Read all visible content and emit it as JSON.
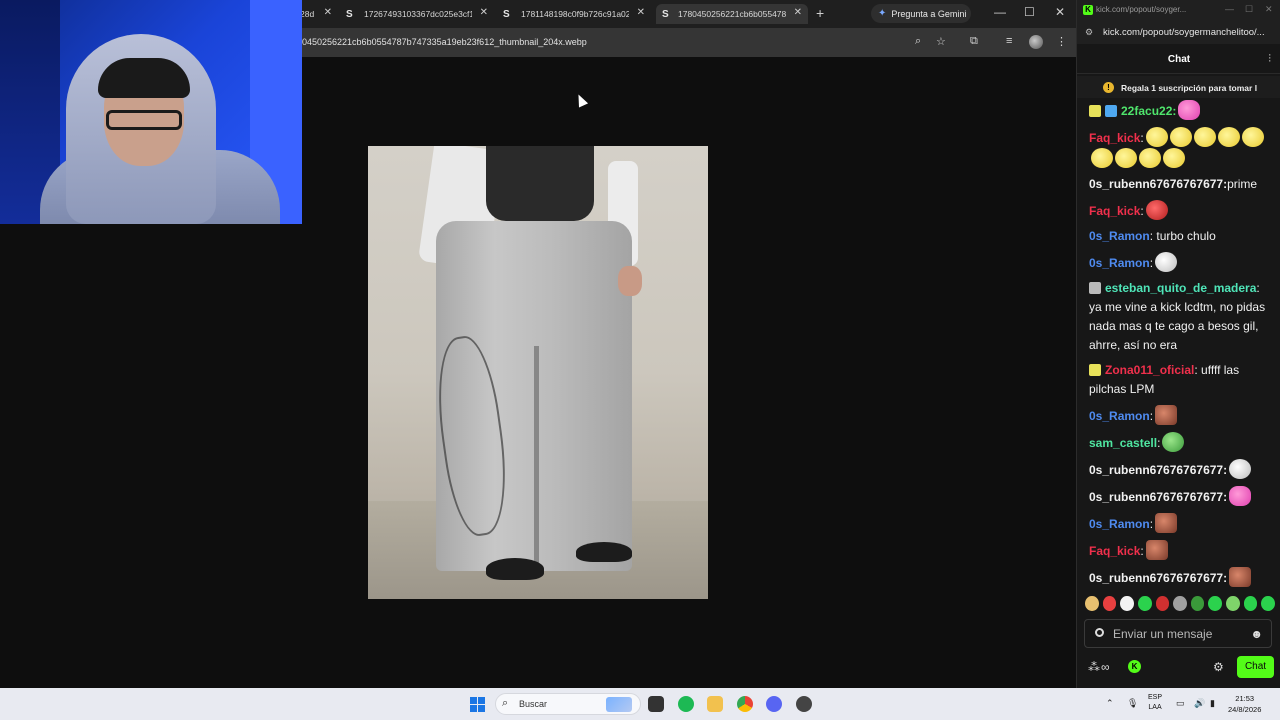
{
  "browser": {
    "tabs": [
      {
        "label": "28d",
        "active": false
      },
      {
        "label": "17267493103367dc025e3cf1f5",
        "active": false
      },
      {
        "label": "1781148198c0f9b726c91a02d",
        "active": false
      },
      {
        "label": "1780450256221cb6b0554787b",
        "active": true
      }
    ],
    "tab_favicon": "S",
    "new_tab": "+",
    "gemini_label": "Pregunta a Gemini",
    "url": "0450256221cb6b0554787b747335a19eb23f612_thumbnail_204x.webp"
  },
  "chat_window": {
    "title_url": "kick.com/popout/soyger...",
    "address": "kick.com/popout/soygermanchelitoo/...",
    "header": "Chat",
    "pinned": "Regala 1 suscripción para tomar l",
    "messages": [
      {
        "user": "22facu22:",
        "text": "",
        "color": "g",
        "badges": [
          "10",
          "sub"
        ],
        "emotes": [
          "em-p"
        ]
      },
      {
        "user": "Faq_kick",
        "text": ":",
        "color": "r",
        "badges": [],
        "emotes": [
          "em-y",
          "em-y",
          "em-y",
          "em-y",
          "em-y",
          "em-y",
          "em-y",
          "em-y",
          "em-y"
        ]
      },
      {
        "user": "0s_rubenn67676767677:",
        "text": "prime",
        "color": "w",
        "badges": [],
        "emotes": []
      },
      {
        "user": "Faq_kick",
        "text": ":",
        "color": "r",
        "badges": [],
        "emotes": [
          "em-r"
        ]
      },
      {
        "user": "0s_Ramon",
        "text": ": turbo chulo",
        "color": "b",
        "badges": [],
        "emotes": []
      },
      {
        "user": "0s_Ramon",
        "text": ":",
        "color": "b",
        "badges": [],
        "emotes": [
          "em-w"
        ]
      },
      {
        "user": "esteban_quito_de_madera",
        "text": ": ya me vine a kick lcdtm, no pidas nada mas q te cago a besos gil, ahrre, así no era",
        "color": "t",
        "badges": [
          "mod"
        ],
        "emotes": []
      },
      {
        "user": "Zona011_oficial",
        "text": ": uffff las pilchas LPM",
        "color": "z",
        "badges": [
          "12"
        ],
        "emotes": []
      },
      {
        "user": "0s_Ramon",
        "text": ":",
        "color": "b",
        "badges": [],
        "emotes": [
          "em-m"
        ]
      },
      {
        "user": "sam_castell",
        "text": ":",
        "color": "a",
        "badges": [],
        "emotes": [
          "em-f"
        ]
      },
      {
        "user": "0s_rubenn67676767677:",
        "text": "",
        "color": "w",
        "badges": [],
        "emotes": [
          "em-w"
        ]
      },
      {
        "user": "0s_rubenn67676767677:",
        "text": "",
        "color": "w",
        "badges": [],
        "emotes": [
          "em-p"
        ]
      },
      {
        "user": "0s_Ramon",
        "text": ":",
        "color": "b",
        "badges": [],
        "emotes": [
          "em-m"
        ]
      },
      {
        "user": "Faq_kick",
        "text": ":",
        "color": "r",
        "badges": [],
        "emotes": [
          "em-m"
        ]
      },
      {
        "user": "0s_rubenn67676767677:",
        "text": "",
        "color": "w",
        "badges": [],
        "emotes": [
          "em-m"
        ]
      }
    ],
    "input_placeholder": "Enviar un mensaje",
    "chat_button": "Chat",
    "kick_logo": "K"
  },
  "taskbar": {
    "search_label": "Buscar",
    "language": "ESP",
    "language_sub": "LAA",
    "time": "21:53",
    "date": "24/8/2026"
  },
  "colors": {
    "kick_green": "#53fc18",
    "chat_bg": "#171717",
    "browser_dark": "#1f1f1f"
  }
}
